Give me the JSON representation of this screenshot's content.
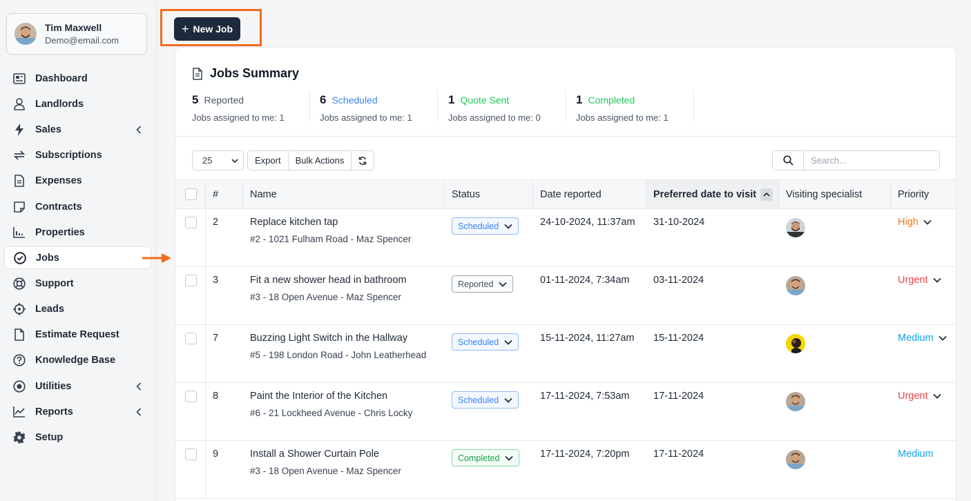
{
  "user": {
    "name": "Tim Maxwell",
    "email": "Demo@email.com"
  },
  "nav": [
    {
      "label": "Dashboard",
      "icon": "dashboard-icon"
    },
    {
      "label": "Landlords",
      "icon": "user-icon"
    },
    {
      "label": "Sales",
      "icon": "bolt-icon",
      "has_submenu": true
    },
    {
      "label": "Subscriptions",
      "icon": "refresh-icon"
    },
    {
      "label": "Expenses",
      "icon": "document-icon"
    },
    {
      "label": "Contracts",
      "icon": "sticky-note-icon"
    },
    {
      "label": "Properties",
      "icon": "chart-bars-icon"
    },
    {
      "label": "Jobs",
      "icon": "check-circle-icon",
      "active": true
    },
    {
      "label": "Support",
      "icon": "lifebuoy-icon"
    },
    {
      "label": "Leads",
      "icon": "crosshair-icon"
    },
    {
      "label": "Estimate Request",
      "icon": "file-icon"
    },
    {
      "label": "Knowledge Base",
      "icon": "question-circle-icon"
    },
    {
      "label": "Utilities",
      "icon": "dot-circle-icon",
      "has_submenu": true
    },
    {
      "label": "Reports",
      "icon": "line-chart-icon",
      "has_submenu": true
    },
    {
      "label": "Setup",
      "icon": "gear-icon"
    }
  ],
  "new_job_label": "New Job",
  "summary": {
    "title": "Jobs Summary",
    "stats": [
      {
        "count": "5",
        "label": "Reported",
        "color": "#4b5563",
        "sub": "Jobs assigned to me: 1"
      },
      {
        "count": "6",
        "label": "Scheduled",
        "color": "#3b82f6",
        "sub": "Jobs assigned to me: 1"
      },
      {
        "count": "1",
        "label": "Quote Sent",
        "color": "#22c55e",
        "sub": "Jobs assigned to me: 0"
      },
      {
        "count": "1",
        "label": "Completed",
        "color": "#22c55e",
        "sub": "Jobs assigned to me: 1"
      }
    ]
  },
  "toolbar": {
    "page_size": "25",
    "export_label": "Export",
    "bulk_actions_label": "Bulk Actions",
    "search_placeholder": "Search..."
  },
  "table": {
    "columns": [
      "#",
      "Name",
      "Status",
      "Date reported",
      "Preferred date to visit",
      "Visiting specialist",
      "Priority"
    ],
    "rows": [
      {
        "id": "2",
        "name": "Replace kitchen tap",
        "sub": "#2 - 1021 Fulham Road - Maz Spencer",
        "status": "Scheduled",
        "date_reported": "24-10-2024, 11:37am",
        "preferred": "31-10-2024",
        "specialist": "bearded-man",
        "priority": "High"
      },
      {
        "id": "3",
        "name": "Fit a new shower head in bathroom",
        "sub": "#3 - 18 Open Avenue - Maz Spencer",
        "status": "Reported",
        "date_reported": "01-11-2024, 7:34am",
        "preferred": "03-11-2024",
        "specialist": "man",
        "priority": "Urgent"
      },
      {
        "id": "7",
        "name": "Buzzing Light Switch in the Hallway",
        "sub": "#5 - 198 London Road - John Leatherhead",
        "status": "Scheduled",
        "date_reported": "15-11-2024, 11:27am",
        "preferred": "15-11-2024",
        "specialist": "yellow",
        "priority": "Medium"
      },
      {
        "id": "8",
        "name": "Paint the Interior of the Kitchen",
        "sub": "#6 - 21 Lockheed Avenue - Chris Locky",
        "status": "Scheduled",
        "date_reported": "17-11-2024, 7:53am",
        "preferred": "17-11-2024",
        "specialist": "man",
        "priority": "Urgent"
      },
      {
        "id": "9",
        "name": "Install a Shower Curtain Pole",
        "sub": "#3 - 18 Open Avenue - Maz Spencer",
        "status": "Completed",
        "date_reported": "17-11-2024, 7:20pm",
        "preferred": "17-11-2024",
        "specialist": "man",
        "priority": "Medium",
        "no_chevron": true
      }
    ]
  },
  "colors": {
    "accent": "#1e293b",
    "highlight": "#f26b1d",
    "status_scheduled": "#3b82f6",
    "status_reported": "#4b5563",
    "status_completed": "#22c55e",
    "priority_high": "#f97316",
    "priority_urgent": "#ef4444",
    "priority_medium": "#0ea5e9"
  }
}
